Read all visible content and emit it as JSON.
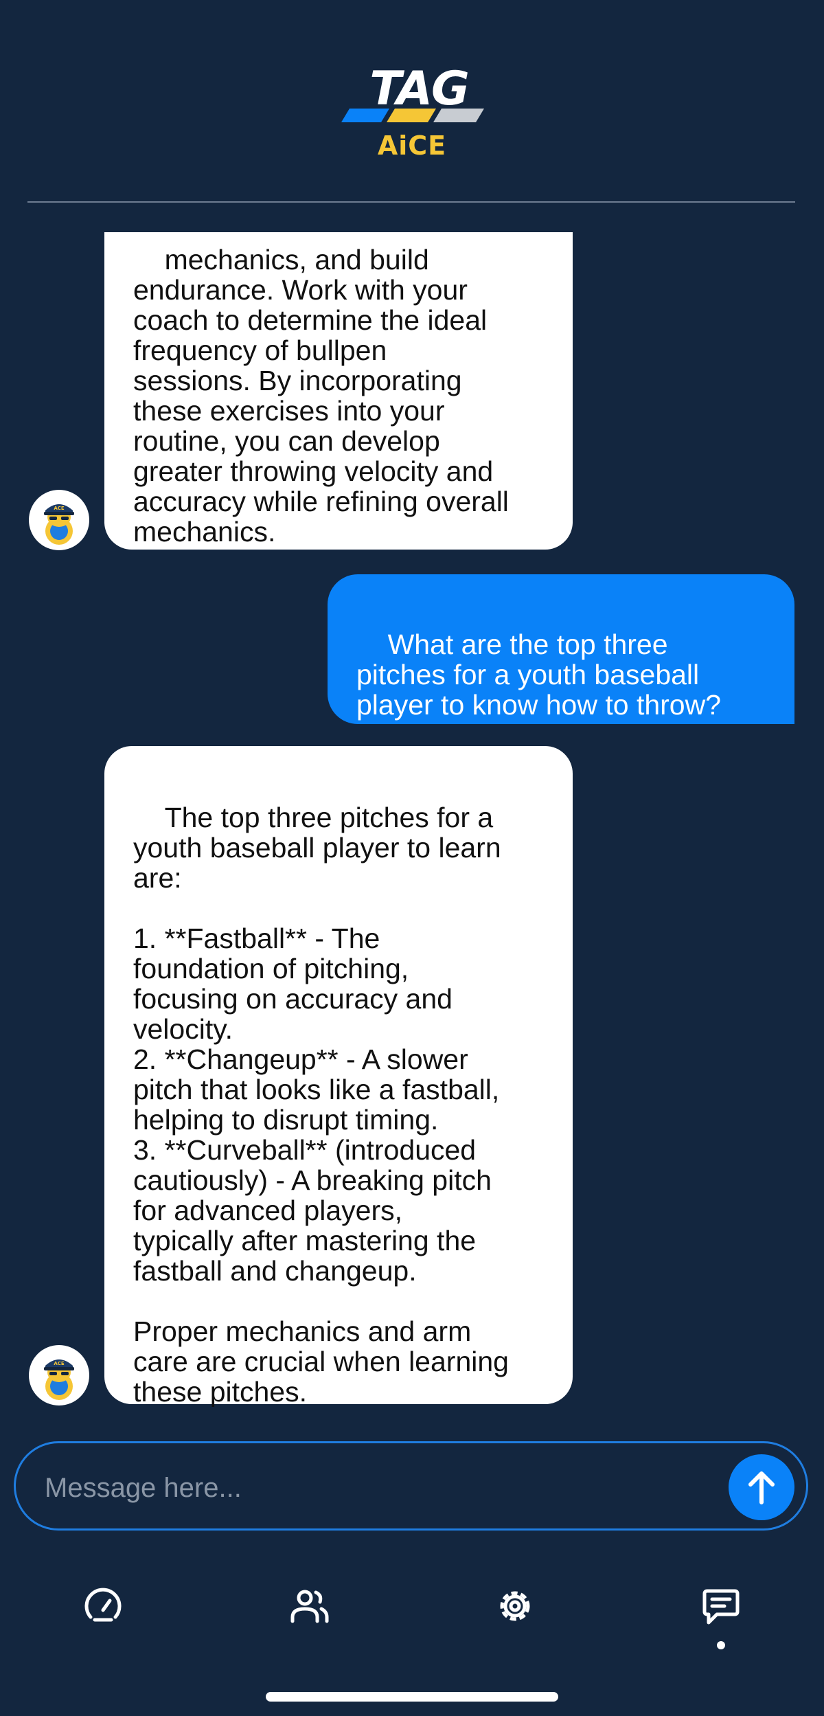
{
  "header": {
    "logo_text": "TAG",
    "logo_subtext": "AiCE",
    "brand_colors": {
      "blue": "#0a82f8",
      "yellow": "#f5c636",
      "gray": "#c8ccd2"
    }
  },
  "messages": [
    {
      "role": "bot",
      "text": "mechanics, and build\nendurance. Work with your\ncoach to determine the ideal\nfrequency of bullpen\nsessions. By incorporating\nthese exercises into your\nroutine, you can develop\ngreater throwing velocity and\naccuracy while refining overall\nmechanics."
    },
    {
      "role": "user",
      "text": "What are the top three\npitches for a youth baseball\nplayer to know how to throw?"
    },
    {
      "role": "bot",
      "text": "The top three pitches for a\nyouth baseball player to learn\nare:\n\n1. **Fastball** - The\nfoundation of pitching,\nfocusing on accuracy and\nvelocity.\n2. **Changeup** - A slower\npitch that looks like a fastball,\nhelping to disrupt timing.\n3. **Curveball** (introduced\ncautiously) - A breaking pitch\nfor advanced players,\ntypically after mastering the\nfastball and changeup.\n\nProper mechanics and arm\ncare are crucial when learning\nthese pitches."
    }
  ],
  "composer": {
    "placeholder": "Message here...",
    "value": "",
    "send_icon": "arrow-up-icon"
  },
  "bottom_nav": [
    {
      "id": "dashboard",
      "icon": "dashboard-gauge-icon",
      "active": false
    },
    {
      "id": "users",
      "icon": "users-icon",
      "active": false
    },
    {
      "id": "settings",
      "icon": "gear-icon",
      "active": false
    },
    {
      "id": "chat",
      "icon": "chat-bubble-icon",
      "active": true
    }
  ],
  "colors": {
    "background": "#13263f",
    "user_bubble": "#0a82f8",
    "bot_bubble": "#ffffff",
    "input_border": "#1f7de0"
  }
}
